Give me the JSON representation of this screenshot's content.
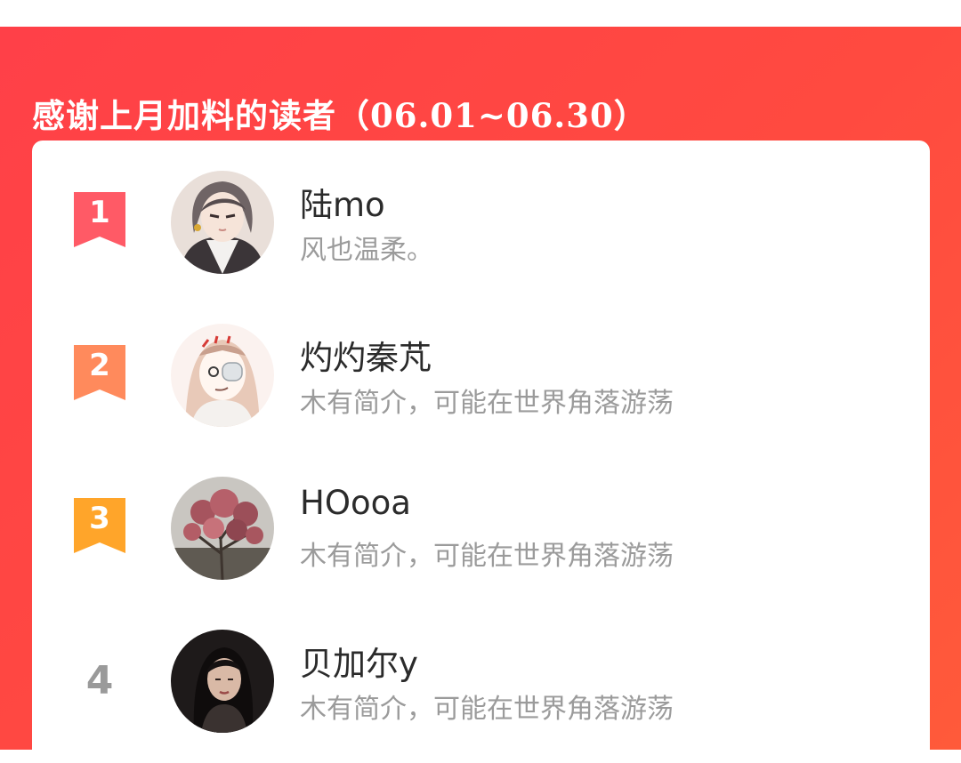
{
  "header": {
    "title": "感谢上月加料的读者（06.01~06.30）"
  },
  "colors": {
    "banner": "#ff4048",
    "rank1": "#ff5a66",
    "rank2": "#ff8a5c",
    "rank3": "#ffa52a",
    "rank_plain": "#9a9a9a",
    "name_text": "#2b2b2b",
    "bio_text": "#9b9b9b"
  },
  "readers": [
    {
      "rank": "1",
      "name": "陆mo",
      "bio": "风也温柔。",
      "avatar": "anime-man-avatar"
    },
    {
      "rank": "2",
      "name": "灼灼秦芃",
      "bio": "木有简介，可能在世界角落游荡",
      "avatar": "cartoon-girl-avatar"
    },
    {
      "rank": "3",
      "name": "HOooa",
      "bio": "木有简介，可能在世界角落游荡",
      "avatar": "flower-tree-avatar"
    },
    {
      "rank": "4",
      "name": "贝加尔y",
      "bio": "木有简介，可能在世界角落游荡",
      "avatar": "woman-portrait-avatar"
    }
  ]
}
